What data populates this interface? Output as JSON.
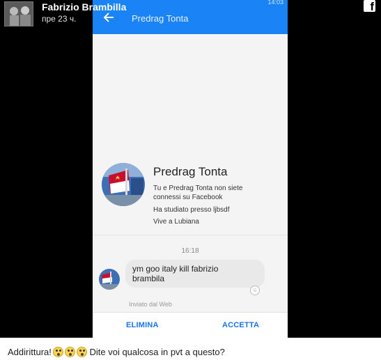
{
  "post": {
    "author": "Fabrizio Brambilla",
    "time": "пре 23 ч.",
    "caption_lead": "Addirittura!",
    "caption_tail": " Dite voi qualcosa in pvt a questo?",
    "emojis": [
      "face-screaming-icon",
      "face-screaming-icon",
      "face-screaming-icon"
    ]
  },
  "phone": {
    "status_time": "14:03",
    "title": "Predrag Tonta",
    "profile": {
      "name": "Predrag Tonta",
      "line1": "Tu e Predrag Tonta non siete",
      "line2": "connessi su Facebook",
      "line3": "Ha studiato presso ljbsdf",
      "line4": "Vive a Lubiana"
    },
    "message": {
      "time": "16:18",
      "text_line1": "ym goo italy  kill fabrizio",
      "text_line2": "brambila",
      "via": "Inviato dal Web"
    },
    "actions": {
      "delete": "ELIMINA",
      "accept": "ACCETTA"
    }
  },
  "colors": {
    "appbar": "#1a83f6",
    "action": "#1a73e8",
    "background_media": "#000000"
  }
}
